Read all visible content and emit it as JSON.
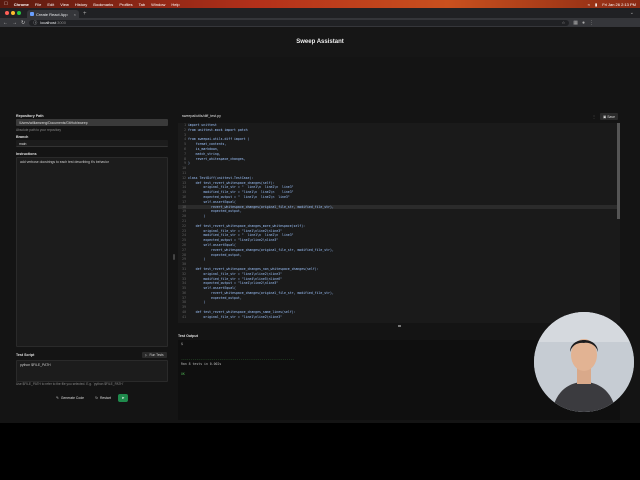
{
  "menubar": {
    "app": "Chrome",
    "items": [
      "File",
      "Edit",
      "View",
      "History",
      "Bookmarks",
      "Profiles",
      "Tab",
      "Window",
      "Help"
    ],
    "clock": "Fri Jan 26  2:13 PM"
  },
  "browser": {
    "tab_title": "Create React App",
    "url_host": "localhost",
    "url_port": ":3000"
  },
  "app": {
    "title": "Sweep Assistant"
  },
  "left": {
    "repo_label": "Repository Path",
    "repo_value": "/Users/williamzeng/Documents/GitHub/sweep",
    "repo_hint": "Absolute path to your repository",
    "branch_label": "Branch",
    "branch_value": "main",
    "instructions_label": "Instructions",
    "instructions_value": "add verbose docstrings to each test describing it's behavior",
    "script_label": "Test Script",
    "run_tests_label": "Run Tests",
    "script_value": "python $FILE_PATH",
    "script_hint": "Use $FILE_PATH to refer to the file you selected. E.g. `python $FILE_PATH`",
    "generate_label": "Generate Code",
    "restart_label": "Restart"
  },
  "editor": {
    "file_path": "sweepai/utils/diff_test.py",
    "save_label": "Save",
    "lines": [
      "import unittest",
      "from unittest.mock import patch",
      "",
      "from sweepai.utils.diff import (",
      "    format_contents,",
      "    is_markdown,",
      "    match_string,",
      "    revert_whitespace_changes,",
      ")",
      "",
      "",
      "class TestDiff(unittest.TestCase):",
      "    def test_revert_whitespace_changes(self):",
      "        original_file_str = \"  line1\\n  line2\\n  line3\"",
      "        modified_file_str = \"line1\\n  line2\\n    line3\"",
      "        expected_output = \"  line1\\n  line2\\n  line3\"",
      "        self.assertEqual(",
      "            revert_whitespace_changes(original_file_str, modified_file_str),",
      "            expected_output,",
      "        )",
      "",
      "    def test_revert_whitespace_changes_more_whitespace(self):",
      "        original_file_str = \"line1\\nline2\\nline3\"",
      "        modified_file_str = \"  line1\\n  line2\\n  line3\"",
      "        expected_output = \"line1\\nline2\\nline3\"",
      "        self.assertEqual(",
      "            revert_whitespace_changes(original_file_str, modified_file_str),",
      "            expected_output,",
      "        )",
      "",
      "    def test_revert_whitespace_changes_non_whitespace_changes(self):",
      "        original_file_str = \"line1\\nline2\\nline3\"",
      "        modified_file_str = \"line4\\nline5\\nline6\"",
      "        expected_output = \"line1\\nline2\\nline3\"",
      "        self.assertEqual(",
      "            revert_whitespace_changes(original_file_str, modified_file_str),",
      "            expected_output,",
      "        )",
      "",
      "    def test_revert_whitespace_changes_same_lines(self):",
      "        original_file_str = \"line1\\nline2\\nline3\""
    ],
    "output_label": "Test Output",
    "terminal_lines": [
      "$",
      "",
      "",
      "-----------------------------------------------------------",
      "Ran 8 tests in 0.002s",
      "",
      "OK"
    ]
  },
  "colors": {
    "accent_green": "#1f8a4c",
    "menubar": "#b3301a"
  }
}
